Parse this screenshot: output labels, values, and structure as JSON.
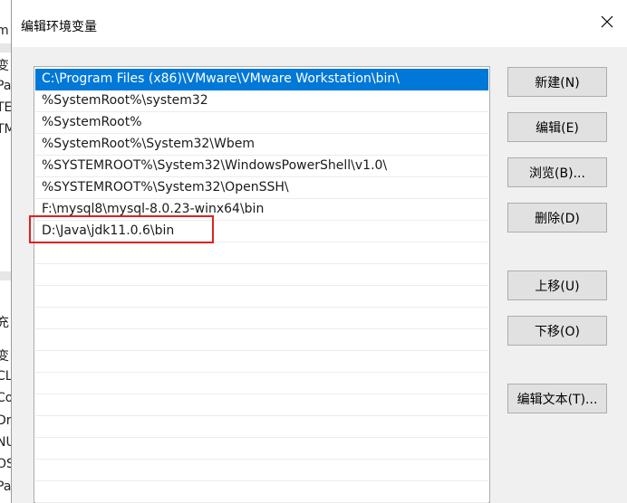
{
  "background_window": {
    "fragments": [
      "m",
      "变",
      "Pa",
      "TE",
      "TM",
      "充",
      "变",
      "CL",
      "Co",
      "Dr",
      "NU",
      "OS",
      "Pa"
    ]
  },
  "dialog": {
    "title": "编辑环境变量",
    "close_icon": "close-icon"
  },
  "path_list": {
    "items": [
      "C:\\Program Files (x86)\\VMware\\VMware Workstation\\bin\\",
      "%SystemRoot%\\system32",
      "%SystemRoot%",
      "%SystemRoot%\\System32\\Wbem",
      "%SYSTEMROOT%\\System32\\WindowsPowerShell\\v1.0\\",
      "%SYSTEMROOT%\\System32\\OpenSSH\\",
      "F:\\mysql8\\mysql-8.0.23-winx64\\bin",
      "D:\\Java\\jdk11.0.6\\bin"
    ],
    "selected_index": 0,
    "highlighted_index": 7
  },
  "buttons": {
    "new": "新建(N)",
    "edit": "编辑(E)",
    "browse": "浏览(B)...",
    "delete": "删除(D)",
    "move_up": "上移(U)",
    "move_down": "下移(O)",
    "edit_text": "编辑文本(T)..."
  },
  "colors": {
    "selection": "#0078d7",
    "highlight_box": "#e02020"
  }
}
